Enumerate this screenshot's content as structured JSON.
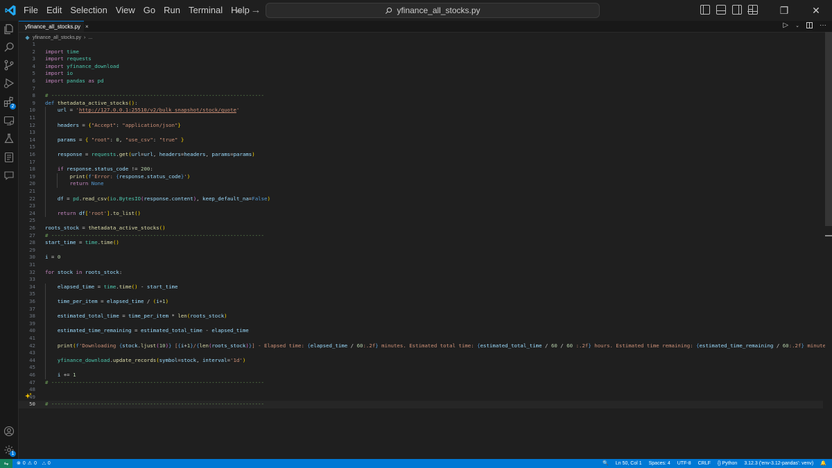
{
  "menu": [
    "File",
    "Edit",
    "Selection",
    "View",
    "Go",
    "Run",
    "Terminal",
    "Help"
  ],
  "command_center": "yfinance_all_stocks.py",
  "tab": {
    "label": "yfinance_all_stocks.py",
    "close": "×"
  },
  "breadcrumb": {
    "file": "yfinance_all_stocks.py",
    "more": "..."
  },
  "extensions_badge": "2",
  "settings_badge": "1",
  "code_lines": [
    {
      "n": "1",
      "tokens": []
    },
    {
      "n": "2",
      "tokens": [
        [
          "kw",
          "import"
        ],
        [
          "plain",
          " "
        ],
        [
          "mod",
          "time"
        ]
      ]
    },
    {
      "n": "3",
      "tokens": [
        [
          "kw",
          "import"
        ],
        [
          "plain",
          " "
        ],
        [
          "mod",
          "requests"
        ]
      ]
    },
    {
      "n": "4",
      "tokens": [
        [
          "kw",
          "import"
        ],
        [
          "plain",
          " "
        ],
        [
          "mod",
          "yfinance_download"
        ]
      ]
    },
    {
      "n": "5",
      "tokens": [
        [
          "kw",
          "import"
        ],
        [
          "plain",
          " "
        ],
        [
          "mod",
          "io"
        ]
      ]
    },
    {
      "n": "6",
      "tokens": [
        [
          "kw",
          "import"
        ],
        [
          "plain",
          " "
        ],
        [
          "mod",
          "pandas"
        ],
        [
          "plain",
          " "
        ],
        [
          "kw",
          "as"
        ],
        [
          "plain",
          " "
        ],
        [
          "mod",
          "pd"
        ]
      ]
    },
    {
      "n": "7",
      "tokens": []
    },
    {
      "n": "8",
      "tokens": [
        [
          "cmt",
          "# ---------------------------------------------------------------------"
        ]
      ]
    },
    {
      "n": "9",
      "tokens": [
        [
          "def",
          "def"
        ],
        [
          "plain",
          " "
        ],
        [
          "fn",
          "thetadata_active_stocks"
        ],
        [
          "b1",
          "()"
        ],
        [
          "plain",
          ":"
        ]
      ]
    },
    {
      "n": "10",
      "tokens": [
        [
          "plain",
          "    "
        ],
        [
          "var",
          "url"
        ],
        [
          "plain",
          " = "
        ],
        [
          "str",
          "'"
        ],
        [
          "link",
          "http://127.0.0.1:25510/v2/bulk_snapshot/stock/quote"
        ],
        [
          "str",
          "'"
        ]
      ]
    },
    {
      "n": "11",
      "tokens": []
    },
    {
      "n": "12",
      "tokens": [
        [
          "plain",
          "    "
        ],
        [
          "var",
          "headers"
        ],
        [
          "plain",
          " = "
        ],
        [
          "b1",
          "{"
        ],
        [
          "str",
          "\"Accept\""
        ],
        [
          "plain",
          ": "
        ],
        [
          "str",
          "\"application/json\""
        ],
        [
          "b1",
          "}"
        ]
      ]
    },
    {
      "n": "13",
      "tokens": []
    },
    {
      "n": "14",
      "tokens": [
        [
          "plain",
          "    "
        ],
        [
          "var",
          "params"
        ],
        [
          "plain",
          " = "
        ],
        [
          "b1",
          "{"
        ],
        [
          "plain",
          " "
        ],
        [
          "str",
          "\"root\""
        ],
        [
          "plain",
          ": "
        ],
        [
          "num",
          "0"
        ],
        [
          "plain",
          ", "
        ],
        [
          "str",
          "\"use_csv\""
        ],
        [
          "plain",
          ": "
        ],
        [
          "str",
          "\"true\""
        ],
        [
          "plain",
          " "
        ],
        [
          "b1",
          "}"
        ]
      ]
    },
    {
      "n": "15",
      "tokens": []
    },
    {
      "n": "16",
      "tokens": [
        [
          "plain",
          "    "
        ],
        [
          "var",
          "response"
        ],
        [
          "plain",
          " = "
        ],
        [
          "mod",
          "requests"
        ],
        [
          "plain",
          "."
        ],
        [
          "fn",
          "get"
        ],
        [
          "b1",
          "("
        ],
        [
          "var",
          "url"
        ],
        [
          "plain",
          "="
        ],
        [
          "var",
          "url"
        ],
        [
          "plain",
          ", "
        ],
        [
          "var",
          "headers"
        ],
        [
          "plain",
          "="
        ],
        [
          "var",
          "headers"
        ],
        [
          "plain",
          ", "
        ],
        [
          "var",
          "params"
        ],
        [
          "plain",
          "="
        ],
        [
          "var",
          "params"
        ],
        [
          "b1",
          ")"
        ]
      ]
    },
    {
      "n": "17",
      "tokens": []
    },
    {
      "n": "18",
      "tokens": [
        [
          "plain",
          "    "
        ],
        [
          "kw",
          "if"
        ],
        [
          "plain",
          " "
        ],
        [
          "var",
          "response"
        ],
        [
          "plain",
          "."
        ],
        [
          "var",
          "status_code"
        ],
        [
          "plain",
          " != "
        ],
        [
          "num",
          "200"
        ],
        [
          "plain",
          ":"
        ]
      ]
    },
    {
      "n": "19",
      "tokens": [
        [
          "plain",
          "        "
        ],
        [
          "fn",
          "print"
        ],
        [
          "b1",
          "("
        ],
        [
          "def",
          "f"
        ],
        [
          "str",
          "'Error: "
        ],
        [
          "def",
          "{"
        ],
        [
          "var",
          "response"
        ],
        [
          "plain",
          "."
        ],
        [
          "var",
          "status_code"
        ],
        [
          "def",
          "}"
        ],
        [
          "str",
          "'"
        ],
        [
          "b1",
          ")"
        ]
      ]
    },
    {
      "n": "20",
      "tokens": [
        [
          "plain",
          "        "
        ],
        [
          "kw",
          "return"
        ],
        [
          "plain",
          " "
        ],
        [
          "kwc",
          "None"
        ]
      ]
    },
    {
      "n": "21",
      "tokens": []
    },
    {
      "n": "22",
      "tokens": [
        [
          "plain",
          "    "
        ],
        [
          "var",
          "df"
        ],
        [
          "plain",
          " = "
        ],
        [
          "mod",
          "pd"
        ],
        [
          "plain",
          "."
        ],
        [
          "fn",
          "read_csv"
        ],
        [
          "b1",
          "("
        ],
        [
          "mod",
          "io"
        ],
        [
          "plain",
          "."
        ],
        [
          "mod",
          "BytesIO"
        ],
        [
          "b2",
          "("
        ],
        [
          "var",
          "response"
        ],
        [
          "plain",
          "."
        ],
        [
          "var",
          "content"
        ],
        [
          "b2",
          ")"
        ],
        [
          "plain",
          ", "
        ],
        [
          "var",
          "keep_default_na"
        ],
        [
          "plain",
          "="
        ],
        [
          "kwc",
          "False"
        ],
        [
          "b1",
          ")"
        ]
      ]
    },
    {
      "n": "23",
      "tokens": []
    },
    {
      "n": "24",
      "tokens": [
        [
          "plain",
          "    "
        ],
        [
          "kw",
          "return"
        ],
        [
          "plain",
          " "
        ],
        [
          "var",
          "df"
        ],
        [
          "b1",
          "["
        ],
        [
          "str",
          "'root'"
        ],
        [
          "b1",
          "]"
        ],
        [
          "plain",
          "."
        ],
        [
          "fn",
          "to_list"
        ],
        [
          "b1",
          "()"
        ]
      ]
    },
    {
      "n": "25",
      "tokens": []
    },
    {
      "n": "26",
      "tokens": [
        [
          "var",
          "roots_stock"
        ],
        [
          "plain",
          " = "
        ],
        [
          "fn",
          "thetadata_active_stocks"
        ],
        [
          "b1",
          "()"
        ]
      ]
    },
    {
      "n": "27",
      "tokens": [
        [
          "cmt",
          "# ---------------------------------------------------------------------"
        ]
      ]
    },
    {
      "n": "28",
      "tokens": [
        [
          "var",
          "start_time"
        ],
        [
          "plain",
          " = "
        ],
        [
          "mod",
          "time"
        ],
        [
          "plain",
          "."
        ],
        [
          "fn",
          "time"
        ],
        [
          "b1",
          "()"
        ]
      ]
    },
    {
      "n": "29",
      "tokens": []
    },
    {
      "n": "30",
      "tokens": [
        [
          "var",
          "i"
        ],
        [
          "plain",
          " = "
        ],
        [
          "num",
          "0"
        ]
      ]
    },
    {
      "n": "31",
      "tokens": []
    },
    {
      "n": "32",
      "tokens": [
        [
          "kw",
          "for"
        ],
        [
          "plain",
          " "
        ],
        [
          "var",
          "stock"
        ],
        [
          "plain",
          " "
        ],
        [
          "kw",
          "in"
        ],
        [
          "plain",
          " "
        ],
        [
          "var",
          "roots_stock"
        ],
        [
          "plain",
          ":"
        ]
      ]
    },
    {
      "n": "33",
      "tokens": []
    },
    {
      "n": "34",
      "tokens": [
        [
          "plain",
          "    "
        ],
        [
          "var",
          "elapsed_time"
        ],
        [
          "plain",
          " = "
        ],
        [
          "mod",
          "time"
        ],
        [
          "plain",
          "."
        ],
        [
          "fn",
          "time"
        ],
        [
          "b1",
          "()"
        ],
        [
          "plain",
          " - "
        ],
        [
          "var",
          "start_time"
        ]
      ]
    },
    {
      "n": "35",
      "tokens": []
    },
    {
      "n": "36",
      "tokens": [
        [
          "plain",
          "    "
        ],
        [
          "var",
          "time_per_item"
        ],
        [
          "plain",
          " = "
        ],
        [
          "var",
          "elapsed_time"
        ],
        [
          "plain",
          " / "
        ],
        [
          "b1",
          "("
        ],
        [
          "var",
          "i"
        ],
        [
          "plain",
          "+"
        ],
        [
          "num",
          "1"
        ],
        [
          "b1",
          ")"
        ]
      ]
    },
    {
      "n": "37",
      "tokens": []
    },
    {
      "n": "38",
      "tokens": [
        [
          "plain",
          "    "
        ],
        [
          "var",
          "estimated_total_time"
        ],
        [
          "plain",
          " = "
        ],
        [
          "var",
          "time_per_item"
        ],
        [
          "plain",
          " * "
        ],
        [
          "fn",
          "len"
        ],
        [
          "b1",
          "("
        ],
        [
          "var",
          "roots_stock"
        ],
        [
          "b1",
          ")"
        ]
      ]
    },
    {
      "n": "39",
      "tokens": []
    },
    {
      "n": "40",
      "tokens": [
        [
          "plain",
          "    "
        ],
        [
          "var",
          "estimated_time_remaining"
        ],
        [
          "plain",
          " = "
        ],
        [
          "var",
          "estimated_total_time"
        ],
        [
          "plain",
          " - "
        ],
        [
          "var",
          "elapsed_time"
        ]
      ]
    },
    {
      "n": "41",
      "tokens": []
    },
    {
      "n": "42",
      "tokens": [
        [
          "plain",
          "    "
        ],
        [
          "fn",
          "print"
        ],
        [
          "b1",
          "("
        ],
        [
          "def",
          "f"
        ],
        [
          "str",
          "'Downloading "
        ],
        [
          "def",
          "{"
        ],
        [
          "var",
          "stock"
        ],
        [
          "plain",
          "."
        ],
        [
          "fn",
          "ljust"
        ],
        [
          "b2",
          "("
        ],
        [
          "num",
          "10"
        ],
        [
          "b2",
          ")"
        ],
        [
          "def",
          "}"
        ],
        [
          "str",
          " ["
        ],
        [
          "def",
          "{"
        ],
        [
          "var",
          "i"
        ],
        [
          "plain",
          "+"
        ],
        [
          "num",
          "1"
        ],
        [
          "def",
          "}"
        ],
        [
          "str",
          "/"
        ],
        [
          "def",
          "{"
        ],
        [
          "fn",
          "len"
        ],
        [
          "b2",
          "("
        ],
        [
          "var",
          "roots_stock"
        ],
        [
          "b2",
          ")"
        ],
        [
          "def",
          "}"
        ],
        [
          "str",
          "] - Elapsed time: "
        ],
        [
          "def",
          "{"
        ],
        [
          "var",
          "elapsed_time"
        ],
        [
          "plain",
          " / "
        ],
        [
          "num",
          "60"
        ],
        [
          "str",
          ":.2f"
        ],
        [
          "def",
          "}"
        ],
        [
          "str",
          " minutes. Estimated total time: "
        ],
        [
          "def",
          "{"
        ],
        [
          "var",
          "estimated_total_time"
        ],
        [
          "plain",
          " / "
        ],
        [
          "num",
          "60"
        ],
        [
          "plain",
          " / "
        ],
        [
          "num",
          "60"
        ],
        [
          "plain",
          " "
        ],
        [
          "str",
          ":.2f"
        ],
        [
          "def",
          "}"
        ],
        [
          "str",
          " hours. Estimated time remaining: "
        ],
        [
          "def",
          "{"
        ],
        [
          "var",
          "estimated_time_remaining"
        ],
        [
          "plain",
          " / "
        ],
        [
          "num",
          "60"
        ],
        [
          "str",
          ":.2f"
        ],
        [
          "def",
          "}"
        ],
        [
          "str",
          " minutes.'"
        ],
        [
          "b1",
          ")"
        ]
      ]
    },
    {
      "n": "43",
      "tokens": []
    },
    {
      "n": "44",
      "tokens": [
        [
          "plain",
          "    "
        ],
        [
          "mod",
          "yfinance_download"
        ],
        [
          "plain",
          "."
        ],
        [
          "fn",
          "update_records"
        ],
        [
          "b1",
          "("
        ],
        [
          "var",
          "symbol"
        ],
        [
          "plain",
          "="
        ],
        [
          "var",
          "stock"
        ],
        [
          "plain",
          ", "
        ],
        [
          "var",
          "interval"
        ],
        [
          "plain",
          "="
        ],
        [
          "str",
          "'1d'"
        ],
        [
          "b1",
          ")"
        ]
      ]
    },
    {
      "n": "45",
      "tokens": []
    },
    {
      "n": "46",
      "tokens": [
        [
          "plain",
          "    "
        ],
        [
          "var",
          "i"
        ],
        [
          "plain",
          " += "
        ],
        [
          "num",
          "1"
        ]
      ]
    },
    {
      "n": "47",
      "tokens": [
        [
          "cmt",
          "# ---------------------------------------------------------------------"
        ]
      ]
    },
    {
      "n": "48",
      "tokens": []
    },
    {
      "n": "49",
      "tokens": []
    },
    {
      "n": "50",
      "tokens": [
        [
          "cmt",
          "# ---------------------------------------------------------------------"
        ]
      ]
    }
  ],
  "current_line": "50",
  "status": {
    "problems_errors": "0",
    "problems_warnings": "0",
    "ports": "0",
    "position": "Ln 50, Col 1",
    "spaces": "Spaces: 4",
    "encoding": "UTF-8",
    "eol": "CRLF",
    "language": "Python",
    "interpreter": "3.12.3 ('env-3.12-pandas': venv)"
  },
  "colors": {
    "accent": "#0078d4",
    "statusbar": "#0078d4",
    "remote": "#16825d",
    "editor_bg": "#1f1f1f"
  }
}
